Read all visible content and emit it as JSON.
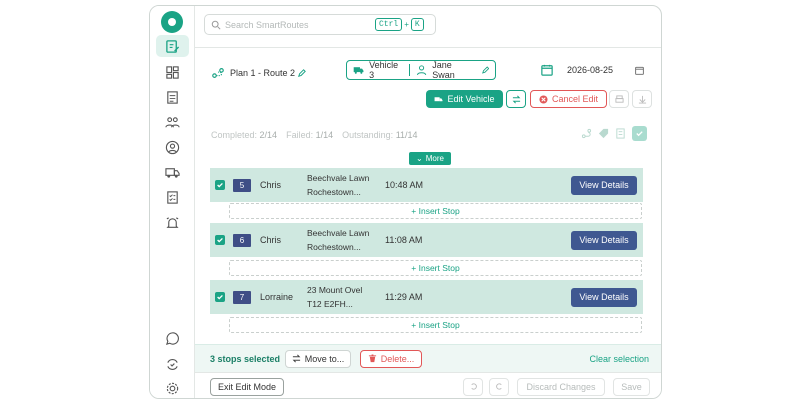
{
  "search": {
    "placeholder": "Search SmartRoutes",
    "shortcut_key1": "Ctrl",
    "shortcut_plus": "+",
    "shortcut_key2": "K"
  },
  "plan": {
    "label": "Plan 1 - Route 2"
  },
  "vehicle": {
    "name": "Vehicle 3",
    "driver": "Jane Swan"
  },
  "date": {
    "value": "2026-08-25"
  },
  "actions": {
    "edit_vehicle": "Edit Vehicle",
    "cancel_edit": "Cancel Edit"
  },
  "stats": {
    "completed_label": "Completed:",
    "completed_value": "2/14",
    "failed_label": "Failed:",
    "failed_value": "1/14",
    "outstanding_label": "Outstanding:",
    "outstanding_value": "11/14"
  },
  "more_label": "More",
  "stops": [
    {
      "number": "5",
      "name": "Chris",
      "address_line1": "Beechvale Lawn",
      "address_line2": "Rochestown...",
      "time": "10:48 AM",
      "button": "View Details",
      "checked": true
    },
    {
      "number": "6",
      "name": "Chris",
      "address_line1": "Beechvale Lawn",
      "address_line2": "Rochestown...",
      "time": "11:08 AM",
      "button": "View Details",
      "checked": true
    },
    {
      "number": "7",
      "name": "Lorraine",
      "address_line1": "23 Mount Ovel",
      "address_line2": "T12 E2FH...",
      "time": "11:29 AM",
      "button": "View Details",
      "checked": true
    }
  ],
  "insert_stop_label": "+ Insert Stop",
  "selection": {
    "text": "3 stops selected",
    "move_to": "Move to...",
    "delete": "Delete...",
    "clear": "Clear selection"
  },
  "footer": {
    "exit_edit_mode": "Exit Edit Mode",
    "discard_changes": "Discard Changes",
    "save": "Save"
  },
  "colors": {
    "accent": "#1aa385",
    "row_bg": "#cfe8e0",
    "view_button": "#3f5891",
    "danger": "#e25757"
  },
  "icons": {
    "rail": [
      "edit-route-icon",
      "dashboard-icon",
      "clipboard-icon",
      "team-icon",
      "user-icon",
      "truck-icon",
      "checklist-icon",
      "alarm-icon"
    ],
    "rail_bottom": [
      "chat-icon",
      "sync-check-icon",
      "settings-icon"
    ]
  }
}
